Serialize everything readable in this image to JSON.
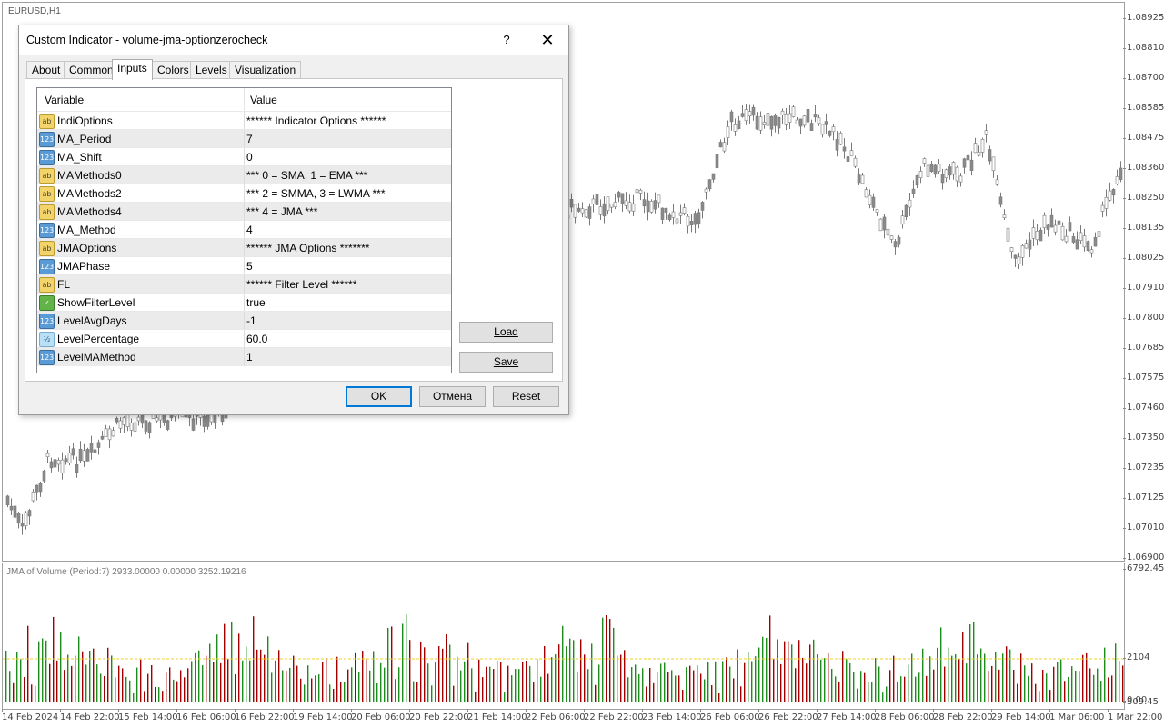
{
  "chart": {
    "symbol": "EURUSD,H1",
    "price_ticks": [
      "1.08925",
      "1.08810",
      "1.08700",
      "1.08585",
      "1.08475",
      "1.08360",
      "1.08250",
      "1.08135",
      "1.08025",
      "1.07910",
      "1.07800",
      "1.07685",
      "1.07575",
      "1.07460",
      "1.07350",
      "1.07235",
      "1.07125",
      "1.07010",
      "1.06900"
    ],
    "time_ticks": [
      "14 Feb 2024",
      "14 Feb 22:00",
      "15 Feb 14:00",
      "16 Feb 06:00",
      "16 Feb 22:00",
      "19 Feb 14:00",
      "20 Feb 06:00",
      "20 Feb 22:00",
      "21 Feb 14:00",
      "22 Feb 06:00",
      "22 Feb 22:00",
      "23 Feb 14:00",
      "26 Feb 06:00",
      "26 Feb 22:00",
      "27 Feb 14:00",
      "28 Feb 06:00",
      "28 Feb 22:00",
      "29 Feb 14:00",
      "1 Mar 06:00",
      "1 Mar 22:00"
    ]
  },
  "indicator_window": {
    "label": "JMA of Volume (Period:7) 2933.00000 0.00000 3252.19216",
    "ticks": [
      "6792.45",
      "2104",
      "0.00",
      "309.45"
    ],
    "level_color": "#f0d020",
    "up_color": "#1c8c1c",
    "down_color": "#a00000"
  },
  "dialog": {
    "title": "Custom Indicator - volume-jma-optionzerocheck",
    "help": "?",
    "close": "✕",
    "tabs": [
      "About",
      "Common",
      "Inputs",
      "Colors",
      "Levels",
      "Visualization"
    ],
    "active_tab": "Inputs",
    "grid": {
      "col_variable": "Variable",
      "col_value": "Value",
      "rows": [
        {
          "icon": "ab",
          "name": "IndiOptions",
          "value": "****** Indicator Options ******"
        },
        {
          "icon": "num",
          "name": "MA_Period",
          "value": "7"
        },
        {
          "icon": "num",
          "name": "MA_Shift",
          "value": "0"
        },
        {
          "icon": "ab",
          "name": "MAMethods0",
          "value": "*** 0 = SMA, 1 = EMA ***"
        },
        {
          "icon": "ab",
          "name": "MAMethods2",
          "value": "*** 2 = SMMA, 3 = LWMA ***"
        },
        {
          "icon": "ab",
          "name": "MAMethods4",
          "value": "*** 4 = JMA ***"
        },
        {
          "icon": "num",
          "name": "MA_Method",
          "value": "4"
        },
        {
          "icon": "ab",
          "name": "JMAOptions",
          "value": "****** JMA Options *******"
        },
        {
          "icon": "num",
          "name": "JMAPhase",
          "value": "5"
        },
        {
          "icon": "ab",
          "name": "FL",
          "value": "****** Filter Level ******"
        },
        {
          "icon": "bool",
          "name": "ShowFilterLevel",
          "value": "true"
        },
        {
          "icon": "num",
          "name": "LevelAvgDays",
          "value": "-1"
        },
        {
          "icon": "dbl",
          "name": "LevelPercentage",
          "value": "60.0"
        },
        {
          "icon": "num",
          "name": "LevelMAMethod",
          "value": "1"
        }
      ]
    },
    "load_label": "Load",
    "save_label": "Save",
    "ok_label": "OK",
    "cancel_label": "Отмена",
    "reset_label": "Reset"
  }
}
